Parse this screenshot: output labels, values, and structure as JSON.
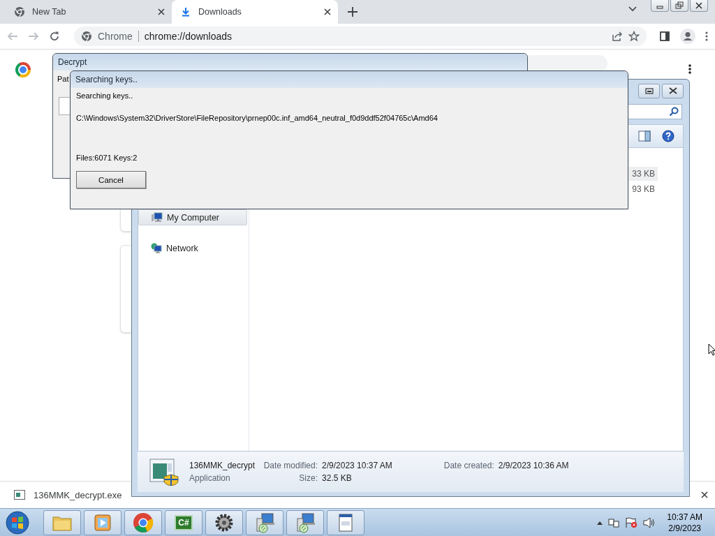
{
  "browser": {
    "tabs": [
      {
        "title": "New Tab",
        "selected": false
      },
      {
        "title": "Downloads",
        "selected": true
      }
    ],
    "omnibox": {
      "chip": "Chrome",
      "url": "chrome://downloads"
    },
    "download_bar": {
      "file": "136MMK_decrypt.exe"
    }
  },
  "explorer": {
    "sizes": [
      {
        "text": "33 KB",
        "selected": true
      },
      {
        "text": "93 KB",
        "selected": false
      }
    ],
    "nav": [
      {
        "label": "My Computer",
        "kind": "computer",
        "selected": true
      },
      {
        "label": "Network",
        "kind": "network",
        "selected": false
      }
    ],
    "details": {
      "name": "136MMK_decrypt",
      "type": "Application",
      "modified_label": "Date modified:",
      "modified": "2/9/2023 10:37 AM",
      "created_label": "Date created:",
      "created": "2/9/2023 10:36 AM",
      "size_label": "Size:",
      "size": "32.5 KB"
    }
  },
  "decrypt_window": {
    "title": "Decrypt",
    "label": "Pat"
  },
  "progress_dialog": {
    "title": "Searching keys..",
    "status": "Searching keys..",
    "path": "C:\\Windows\\System32\\DriverStore\\FileRepository\\prnep00c.inf_amd64_neutral_f0d9ddf52f04765c\\Amd64",
    "counts": "Files:6071 Keys:2",
    "button": "Cancel"
  },
  "taskbar": {
    "items": [
      {
        "kind": "folder"
      },
      {
        "kind": "media"
      },
      {
        "kind": "chrome"
      },
      {
        "kind": "code",
        "label": "C#"
      },
      {
        "kind": "gear"
      },
      {
        "kind": "setup"
      },
      {
        "kind": "setup"
      },
      {
        "kind": "document"
      }
    ],
    "clock": {
      "time": "10:37 AM",
      "date": "2/9/2023"
    }
  }
}
